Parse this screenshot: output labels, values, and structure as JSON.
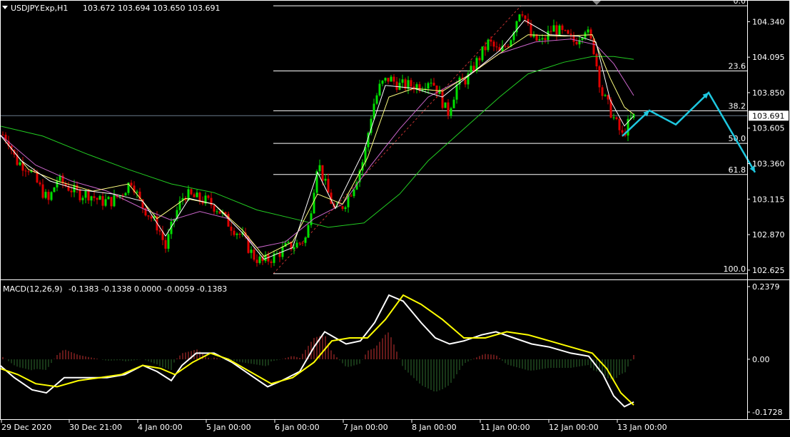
{
  "header": {
    "title": "USDJPY.Exp,H1",
    "ohlc": "103.672 103.694 103.650 103.691"
  },
  "macd": {
    "label": "MACD(12,26,9)",
    "values": "-0.1383 -0.1338 0.0000 -0.0059 -0.1383"
  },
  "colors": {
    "background": "#000000",
    "frame": "#ffffff",
    "bull_candle": "#00e000",
    "bear_candle": "#e00000",
    "ma_fast": "#ffffff",
    "ma_mid": "#ffff80",
    "ma_purple": "#cc66cc",
    "ma_slow": "#22cc22",
    "fib": "#ffffff",
    "projection": "#1ec8e0",
    "macd_main": "#ffffff",
    "macd_signal": "#ffff00",
    "hist_pos": "#c83232",
    "hist_neg": "#2e6b2e",
    "current_price_bg": "#ffffff"
  },
  "chart_data": [
    {
      "type": "candlestick",
      "title": "USDJPY.Exp,H1",
      "ylim": [
        102.58,
        104.47
      ],
      "yticks": [
        104.34,
        104.095,
        103.85,
        103.605,
        103.36,
        103.115,
        102.87,
        102.625
      ],
      "ytick_labels": [
        "104.340",
        "104.095",
        "103.850",
        "103.605",
        "103.360",
        "103.115",
        "102.870",
        "102.625"
      ],
      "xtick_labels": [
        "29 Dec 2020",
        "30 Dec 21:00",
        "4 Jan 00:00",
        "5 Jan 00:00",
        "6 Jan 00:00",
        "7 Jan 00:00",
        "8 Jan 00:00",
        "11 Jan 00:00",
        "12 Jan 00:00",
        "13 Jan 00:00"
      ],
      "current_price": "103.691",
      "price_path": [
        [
          0,
          103.58
        ],
        [
          12,
          103.52
        ],
        [
          22,
          103.38
        ],
        [
          40,
          103.33
        ],
        [
          55,
          103.2
        ],
        [
          68,
          103.1
        ],
        [
          80,
          103.25
        ],
        [
          95,
          103.2
        ],
        [
          110,
          103.15
        ],
        [
          125,
          103.15
        ],
        [
          140,
          103.1
        ],
        [
          155,
          103.1
        ],
        [
          170,
          103.15
        ],
        [
          185,
          103.25
        ],
        [
          195,
          103.1
        ],
        [
          210,
          103.0
        ],
        [
          222,
          102.92
        ],
        [
          232,
          102.78
        ],
        [
          245,
          103.0
        ],
        [
          258,
          103.15
        ],
        [
          275,
          103.12
        ],
        [
          290,
          103.1
        ],
        [
          305,
          103.05
        ],
        [
          320,
          102.95
        ],
        [
          340,
          102.85
        ],
        [
          355,
          102.72
        ],
        [
          368,
          102.68
        ],
        [
          385,
          102.72
        ],
        [
          400,
          102.78
        ],
        [
          415,
          102.8
        ],
        [
          430,
          102.85
        ],
        [
          445,
          103.38
        ],
        [
          458,
          103.18
        ],
        [
          470,
          103.02
        ],
        [
          482,
          103.08
        ],
        [
          495,
          103.2
        ],
        [
          510,
          103.4
        ],
        [
          522,
          103.75
        ],
        [
          533,
          103.9
        ],
        [
          545,
          103.95
        ],
        [
          560,
          103.9
        ],
        [
          575,
          103.9
        ],
        [
          590,
          103.9
        ],
        [
          603,
          103.95
        ],
        [
          615,
          103.85
        ],
        [
          627,
          103.7
        ],
        [
          640,
          103.9
        ],
        [
          655,
          103.95
        ],
        [
          670,
          104.08
        ],
        [
          685,
          104.2
        ],
        [
          700,
          104.12
        ],
        [
          715,
          104.22
        ],
        [
          730,
          104.45
        ],
        [
          745,
          104.22
        ],
        [
          760,
          104.2
        ],
        [
          775,
          104.3
        ],
        [
          790,
          104.25
        ],
        [
          805,
          104.2
        ],
        [
          820,
          104.3
        ],
        [
          832,
          104.15
        ],
        [
          843,
          103.85
        ],
        [
          853,
          103.75
        ],
        [
          862,
          103.65
        ],
        [
          872,
          103.55
        ],
        [
          882,
          103.65
        ],
        [
          890,
          103.691
        ]
      ],
      "ma_lines": [
        {
          "name": "ma_slow",
          "color": "#22cc22",
          "points": [
            [
              0,
              103.62
            ],
            [
              60,
              103.55
            ],
            [
              120,
              103.43
            ],
            [
              180,
              103.32
            ],
            [
              240,
              103.22
            ],
            [
              300,
              103.16
            ],
            [
              360,
              103.04
            ],
            [
              420,
              102.97
            ],
            [
              460,
              102.92
            ],
            [
              510,
              102.95
            ],
            [
              560,
              103.15
            ],
            [
              600,
              103.38
            ],
            [
              650,
              103.6
            ],
            [
              700,
              103.82
            ],
            [
              740,
              103.98
            ],
            [
              790,
              104.06
            ],
            [
              830,
              104.1
            ],
            [
              860,
              104.1
            ],
            [
              888,
              104.08
            ]
          ]
        },
        {
          "name": "ma_purple",
          "color": "#cc66cc",
          "points": [
            [
              0,
              103.56
            ],
            [
              50,
              103.35
            ],
            [
              100,
              103.24
            ],
            [
              150,
              103.17
            ],
            [
              200,
              103.05
            ],
            [
              240,
              102.97
            ],
            [
              280,
              103.03
            ],
            [
              320,
              102.98
            ],
            [
              360,
              102.78
            ],
            [
              400,
              102.82
            ],
            [
              440,
              102.98
            ],
            [
              480,
              103.08
            ],
            [
              520,
              103.35
            ],
            [
              560,
              103.6
            ],
            [
              600,
              103.82
            ],
            [
              650,
              103.95
            ],
            [
              700,
              104.12
            ],
            [
              750,
              104.2
            ],
            [
              800,
              104.22
            ],
            [
              835,
              104.18
            ],
            [
              860,
              104.05
            ],
            [
              888,
              103.83
            ]
          ]
        },
        {
          "name": "ma_mid",
          "color": "#ffff80",
          "points": [
            [
              0,
              103.56
            ],
            [
              40,
              103.32
            ],
            [
              80,
              103.24
            ],
            [
              130,
              103.17
            ],
            [
              180,
              103.22
            ],
            [
              220,
              102.98
            ],
            [
              260,
              103.12
            ],
            [
              300,
              103.08
            ],
            [
              340,
              102.9
            ],
            [
              370,
              102.72
            ],
            [
              410,
              102.82
            ],
            [
              445,
              103.15
            ],
            [
              480,
              103.08
            ],
            [
              515,
              103.4
            ],
            [
              545,
              103.82
            ],
            [
              580,
              103.88
            ],
            [
              620,
              103.86
            ],
            [
              660,
              103.98
            ],
            [
              700,
              104.12
            ],
            [
              740,
              104.25
            ],
            [
              790,
              104.24
            ],
            [
              830,
              104.25
            ],
            [
              855,
              103.95
            ],
            [
              875,
              103.75
            ],
            [
              888,
              103.7
            ]
          ]
        },
        {
          "name": "ma_fast",
          "color": "#ffffff",
          "points": [
            [
              0,
              103.56
            ],
            [
              30,
              103.38
            ],
            [
              70,
              103.24
            ],
            [
              110,
              103.18
            ],
            [
              160,
              103.15
            ],
            [
              200,
              103.1
            ],
            [
              232,
              102.86
            ],
            [
              265,
              103.12
            ],
            [
              300,
              103.08
            ],
            [
              340,
              102.88
            ],
            [
              370,
              102.7
            ],
            [
              410,
              102.78
            ],
            [
              445,
              103.3
            ],
            [
              470,
              103.05
            ],
            [
              510,
              103.45
            ],
            [
              540,
              103.9
            ],
            [
              580,
              103.88
            ],
            [
              620,
              103.82
            ],
            [
              660,
              103.98
            ],
            [
              700,
              104.14
            ],
            [
              735,
              104.35
            ],
            [
              770,
              104.25
            ],
            [
              810,
              104.24
            ],
            [
              835,
              104.2
            ],
            [
              855,
              103.8
            ],
            [
              875,
              103.62
            ],
            [
              888,
              103.69
            ]
          ]
        }
      ],
      "fibonacci": {
        "anchor_x": [
          383,
          1047
        ],
        "levels": [
          {
            "label": "0.0",
            "price": 104.45
          },
          {
            "label": "23.6",
            "price": 104.0
          },
          {
            "label": "38.2",
            "price": 103.725
          },
          {
            "label": "50.0",
            "price": 103.5
          },
          {
            "label": "61.8",
            "price": 103.285
          },
          {
            "label": "100.0",
            "price": 102.6
          }
        ],
        "trend_from": [
          383,
          102.6
        ],
        "trend_to": [
          730,
          104.45
        ]
      },
      "projection_arrow": [
        [
          872,
          103.55
        ],
        [
          910,
          103.727
        ],
        [
          947,
          103.63
        ],
        [
          993,
          103.85
        ],
        [
          1058,
          103.3
        ]
      ]
    },
    {
      "type": "macd",
      "title": "MACD(12,26,9)",
      "ylim": [
        -0.1728,
        0.2379
      ],
      "ytick_labels": [
        "0.2379",
        "0.00",
        "-0.1728"
      ],
      "macd": [
        [
          0,
          -0.02
        ],
        [
          20,
          -0.06
        ],
        [
          45,
          -0.1
        ],
        [
          65,
          -0.11
        ],
        [
          90,
          -0.06
        ],
        [
          120,
          -0.06
        ],
        [
          150,
          -0.06
        ],
        [
          175,
          -0.05
        ],
        [
          200,
          -0.02
        ],
        [
          220,
          -0.04
        ],
        [
          240,
          -0.07
        ],
        [
          255,
          -0.02
        ],
        [
          275,
          0.02
        ],
        [
          300,
          0.02
        ],
        [
          325,
          -0.01
        ],
        [
          350,
          -0.05
        ],
        [
          375,
          -0.09
        ],
        [
          395,
          -0.07
        ],
        [
          420,
          -0.04
        ],
        [
          440,
          0.04
        ],
        [
          455,
          0.09
        ],
        [
          470,
          0.07
        ],
        [
          485,
          0.05
        ],
        [
          505,
          0.06
        ],
        [
          525,
          0.12
        ],
        [
          545,
          0.21
        ],
        [
          565,
          0.19
        ],
        [
          590,
          0.12
        ],
        [
          610,
          0.07
        ],
        [
          630,
          0.05
        ],
        [
          650,
          0.06
        ],
        [
          675,
          0.08
        ],
        [
          695,
          0.09
        ],
        [
          720,
          0.07
        ],
        [
          745,
          0.05
        ],
        [
          770,
          0.04
        ],
        [
          800,
          0.02
        ],
        [
          825,
          0.01
        ],
        [
          845,
          -0.05
        ],
        [
          860,
          -0.12
        ],
        [
          875,
          -0.155
        ],
        [
          888,
          -0.14
        ]
      ],
      "signal": [
        [
          0,
          -0.03
        ],
        [
          25,
          -0.05
        ],
        [
          50,
          -0.08
        ],
        [
          80,
          -0.09
        ],
        [
          110,
          -0.07
        ],
        [
          140,
          -0.06
        ],
        [
          170,
          -0.05
        ],
        [
          200,
          -0.02
        ],
        [
          225,
          -0.03
        ],
        [
          245,
          -0.05
        ],
        [
          270,
          -0.01
        ],
        [
          295,
          0.02
        ],
        [
          320,
          0.0
        ],
        [
          350,
          -0.04
        ],
        [
          380,
          -0.08
        ],
        [
          410,
          -0.06
        ],
        [
          440,
          -0.01
        ],
        [
          465,
          0.06
        ],
        [
          490,
          0.07
        ],
        [
          515,
          0.07
        ],
        [
          540,
          0.13
        ],
        [
          565,
          0.21
        ],
        [
          590,
          0.18
        ],
        [
          620,
          0.13
        ],
        [
          650,
          0.07
        ],
        [
          680,
          0.07
        ],
        [
          710,
          0.09
        ],
        [
          740,
          0.08
        ],
        [
          770,
          0.06
        ],
        [
          800,
          0.04
        ],
        [
          830,
          0.02
        ],
        [
          850,
          -0.03
        ],
        [
          870,
          -0.11
        ],
        [
          888,
          -0.15
        ]
      ],
      "histogram_x_step": 4
    }
  ]
}
